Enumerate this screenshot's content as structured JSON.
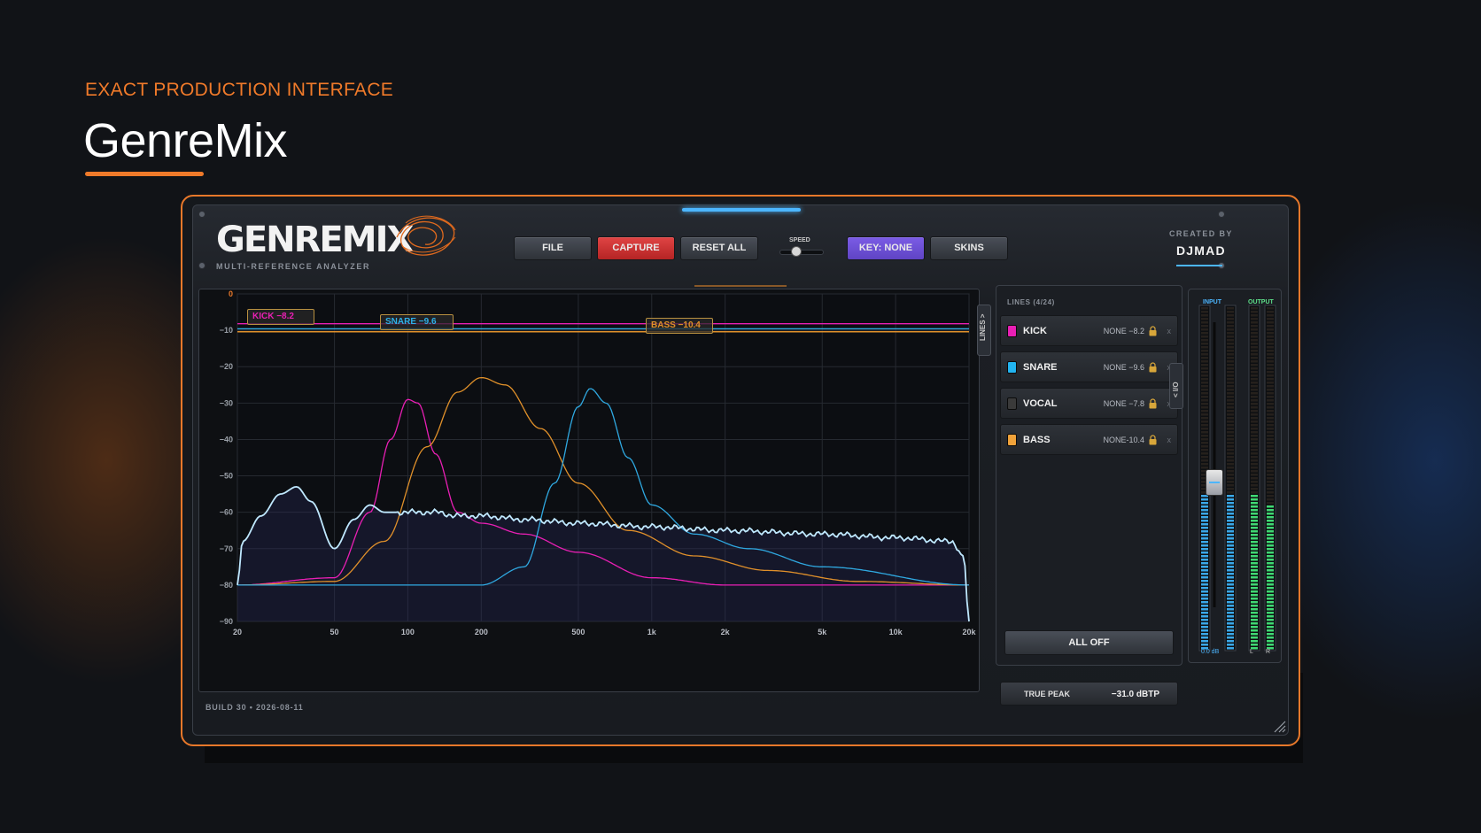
{
  "page": {
    "eyebrow": "EXACT PRODUCTION INTERFACE",
    "title": "GenreMix"
  },
  "plugin": {
    "logo": "GENREMIX",
    "subtitle": "MULTI-REFERENCE ANALYZER",
    "created_by_label": "CREATED BY",
    "author": "DJMAD",
    "build": "BUILD 30 • 2026-08-11",
    "colors": {
      "accent_orange": "#e8782a",
      "accent_blue": "#4cb6ff",
      "capture_red": "#d23434",
      "key_purple": "#6e52d8"
    }
  },
  "toolbar": {
    "file": "FILE",
    "capture": "CAPTURE",
    "reset_all": "RESET ALL",
    "speed_label": "SPEED",
    "key": "KEY: NONE",
    "skins": "SKINS"
  },
  "graph": {
    "side_tab": "LINES >",
    "tags": {
      "kick": "KICK  −8.2",
      "snare": "SNARE  −9.6",
      "bass": "BASS  −10.4"
    }
  },
  "chart_data": {
    "type": "line",
    "xscale": "log",
    "xlim": [
      20,
      20000
    ],
    "ylim": [
      -90,
      0
    ],
    "x_ticks": [
      "20",
      "50",
      "100",
      "200",
      "500",
      "1k",
      "2k",
      "5k",
      "10k",
      "20k"
    ],
    "x_tick_values": [
      20,
      50,
      100,
      200,
      500,
      1000,
      2000,
      5000,
      10000,
      20000
    ],
    "y_ticks": [
      "0",
      "−10",
      "−20",
      "−30",
      "−40",
      "−50",
      "−60",
      "−70",
      "−80",
      "−90"
    ],
    "y_tick_values": [
      0,
      -10,
      -20,
      -30,
      -40,
      -50,
      -60,
      -70,
      -80,
      -90
    ],
    "series": [
      {
        "color": "#e81fb4",
        "x": [
          20,
          50,
          70,
          85,
          100,
          110,
          130,
          160,
          200,
          300,
          500,
          1000,
          2000,
          20000
        ],
        "y": [
          -80,
          -78,
          -60,
          -40,
          -29,
          -30,
          -44,
          -60,
          -63,
          -66,
          -71,
          -78,
          -80,
          -80
        ]
      },
      {
        "color": "#e0902a",
        "x": [
          20,
          50,
          80,
          120,
          160,
          200,
          250,
          350,
          500,
          800,
          1500,
          3000,
          7000,
          20000
        ],
        "y": [
          -80,
          -79,
          -68,
          -42,
          -27,
          -23,
          -25,
          -37,
          -52,
          -65,
          -72,
          -76,
          -79,
          -80
        ]
      },
      {
        "color": "#2fa8e0",
        "x": [
          20,
          200,
          300,
          400,
          500,
          560,
          650,
          800,
          1000,
          1500,
          2500,
          5000,
          20000
        ],
        "y": [
          -80,
          -80,
          -75,
          -52,
          -31,
          -26,
          -30,
          -45,
          -58,
          -66,
          -70,
          -75,
          -80
        ]
      },
      {
        "color": "#bfe8ff",
        "x": [
          20,
          21,
          25,
          30,
          35,
          40,
          50,
          60,
          70,
          80,
          90,
          100,
          130,
          160,
          200,
          300,
          500,
          1000,
          2000,
          5000,
          10000,
          17000,
          19000,
          20000
        ],
        "y": [
          -80,
          -68,
          -61,
          -55,
          -53,
          -57,
          -70,
          -62,
          -58,
          -60,
          -60,
          -60,
          -60,
          -61,
          -61,
          -62,
          -63,
          -64,
          -65,
          -66,
          -67,
          -68,
          -72,
          -90
        ]
      }
    ],
    "reference_lines": [
      {
        "color": "#e81fb4",
        "y": -8.2
      },
      {
        "color": "#2fa8e0",
        "y": -9.6
      },
      {
        "color": "#e0902a",
        "y": -10.4
      }
    ]
  },
  "lines_panel": {
    "header": "LINES (4/24)",
    "rows": [
      {
        "name": "KICK",
        "value": "NONE −8.2",
        "color": "#e81fb4",
        "x": "x"
      },
      {
        "name": "SNARE",
        "value": "NONE −9.6",
        "color": "#22b4f0",
        "x": "x"
      },
      {
        "name": "VOCAL",
        "value": "NONE −7.8",
        "color": "#3a3a3a",
        "x": "x"
      },
      {
        "name": "BASS",
        "value": "NONE-10.4",
        "color": "#f0a23a",
        "x": "x"
      }
    ],
    "all_off": "ALL OFF",
    "io_tab": "< I/O",
    "true_peak_label": "TRUE PEAK",
    "true_peak_value": "−31.0 dBTP"
  },
  "meters": {
    "input_label": "INPUT",
    "output_label": "OUTPUT",
    "gain_readout": "0.0 dB",
    "l": "L",
    "r": "R"
  }
}
